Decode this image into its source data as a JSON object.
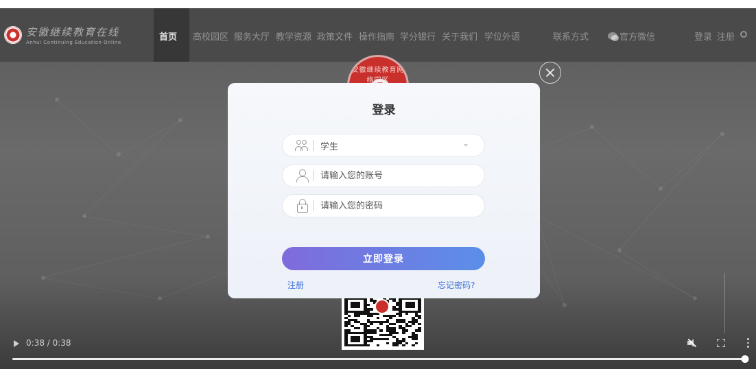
{
  "header": {
    "logo_cn": "安徽继续教育在线",
    "logo_en": "Anhui Continuing Education Online",
    "nav_items": [
      {
        "label": "首页",
        "active": true
      },
      {
        "label": "高校园区",
        "active": false
      },
      {
        "label": "服务大厅",
        "active": false
      },
      {
        "label": "教学资源",
        "active": false
      },
      {
        "label": "政策文件",
        "active": false
      },
      {
        "label": "操作指南",
        "active": false
      },
      {
        "label": "学分银行",
        "active": false
      },
      {
        "label": "关于我们",
        "active": false
      },
      {
        "label": "学位外语",
        "active": false
      }
    ],
    "contact_label": "联系方式",
    "wechat_label": "官方微信",
    "login_label": "登录",
    "register_label": "注册"
  },
  "seal": {
    "text": "安徽继续教育网络园区"
  },
  "login_modal": {
    "title": "登录",
    "role_select": {
      "value": "学生"
    },
    "account_input": {
      "placeholder": "请输入您的账号",
      "value": ""
    },
    "password_input": {
      "placeholder": "请输入您的密码",
      "value": ""
    },
    "submit_label": "立即登录",
    "register_link": "注册",
    "forgot_link": "忘记密码?"
  },
  "video_player": {
    "time_display": "0:38 / 0:38",
    "progress": 1.0,
    "muted": true
  },
  "colors": {
    "button_gradient_start": "#7f6bdc",
    "button_gradient_end": "#5b8fe9",
    "link": "#3c6fd6",
    "brand_red": "#c9302c"
  },
  "icons": [
    "logo-emblem",
    "wechat-icon",
    "search-icon",
    "close-icon",
    "users-icon",
    "user-icon",
    "lock-icon",
    "dropdown-arrow-icon",
    "play-icon",
    "mute-icon",
    "fullscreen-icon",
    "more-icon"
  ]
}
